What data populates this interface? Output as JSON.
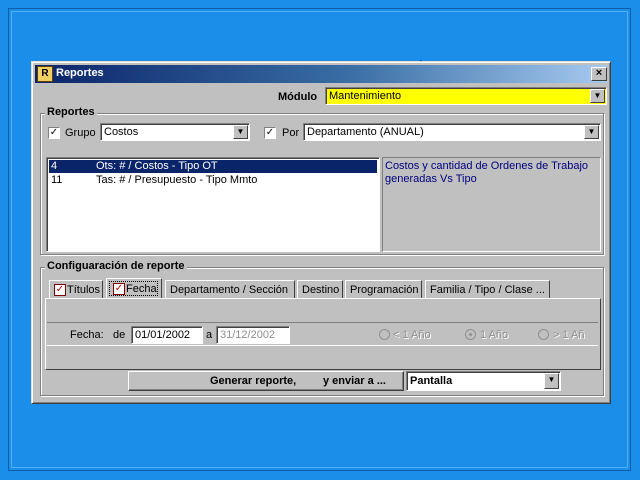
{
  "window": {
    "title": "Reportes",
    "close_glyph": "×"
  },
  "modulo": {
    "label": "Módulo",
    "value": "Mantenimiento",
    "highlight": "#ffff00"
  },
  "reportes_group": {
    "title": "Reportes",
    "grupo": {
      "checked": true,
      "label": "Grupo",
      "value": "Costos"
    },
    "por": {
      "checked": true,
      "label": "Por",
      "value": "Departamento (ANUAL)"
    },
    "list": [
      {
        "id": "4",
        "text": "Ots: # / Costos - Tipo OT",
        "selected": true
      },
      {
        "id": "11",
        "text": "Tas: # / Presupuesto - Tipo Mmto",
        "selected": false
      }
    ],
    "description": "Costos y cantidad de Ordenes de Trabajo generadas Vs Tipo",
    "description_color": "#000080"
  },
  "config_group": {
    "title": "Configuaración de reporte",
    "tabs": [
      {
        "label": "Títulos",
        "checked": true
      },
      {
        "label": "Fecha",
        "checked": true,
        "active": true
      },
      {
        "label": "Departamento / Sección"
      },
      {
        "label": "Destino"
      },
      {
        "label": "Programación"
      },
      {
        "label": "Familia / Tipo / Clase ..."
      }
    ],
    "fecha": {
      "label": "Fecha:",
      "de_label": "de",
      "from": "01/01/2002",
      "a_label": "a",
      "to": "31/12/2002",
      "options": [
        {
          "label": "< 1 Año",
          "selected": false
        },
        {
          "label": "1 Año",
          "selected": true
        },
        {
          "label": "> 1 Añ",
          "selected": false
        }
      ]
    }
  },
  "generar": {
    "label_1": "Generar reporte,",
    "label_2": "y enviar a ...",
    "destino": "Pantalla"
  },
  "icons": {
    "dropdown": "▼",
    "check": "✓"
  }
}
